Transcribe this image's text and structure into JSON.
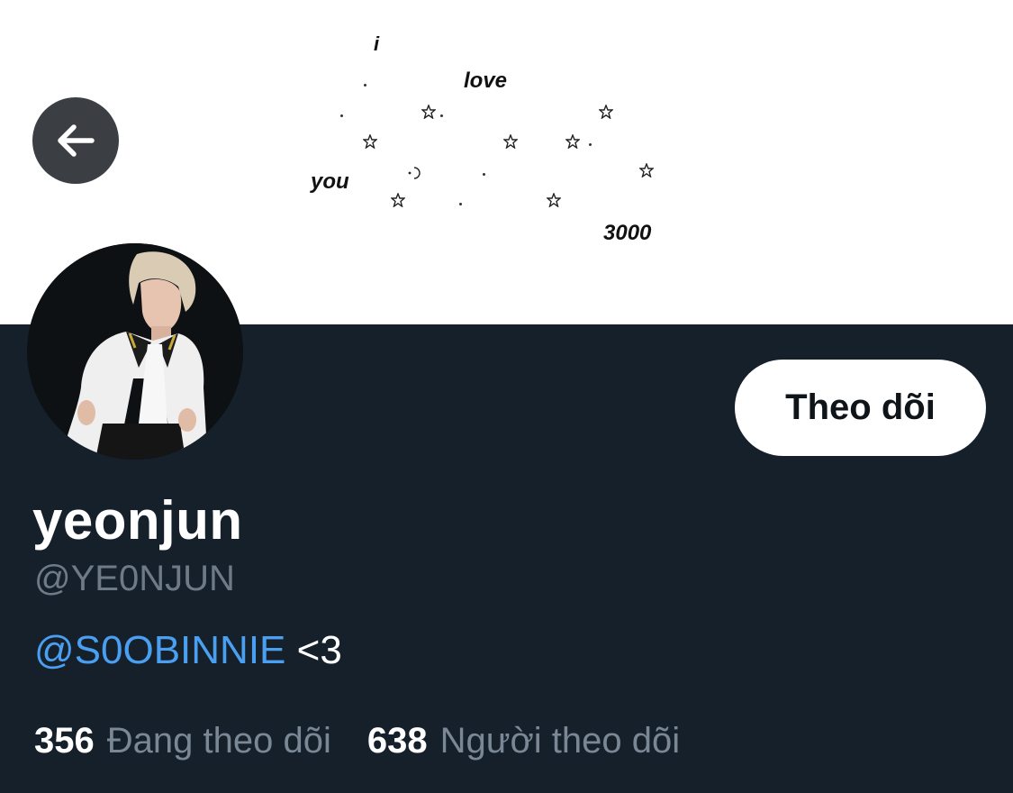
{
  "banner": {
    "words": [
      "i",
      "love",
      "you",
      "3000"
    ]
  },
  "icons": {
    "back": "arrow-left-icon",
    "star": "star-icon",
    "moon": "crescent-moon-icon"
  },
  "profile": {
    "display_name": "yeonjun",
    "handle": "@YE0NJUN",
    "bio_mention": "@S0OBINNIE",
    "bio_text": " <3"
  },
  "actions": {
    "follow_label": "Theo dõi"
  },
  "stats": {
    "following_count": "356",
    "following_label": "Đang theo dõi",
    "followers_count": "638",
    "followers_label": "Người theo dõi"
  },
  "colors": {
    "background": "#15202b",
    "accent_link": "#4a9ff0",
    "muted_text": "#6e7b87",
    "button_bg": "#ffffff"
  }
}
